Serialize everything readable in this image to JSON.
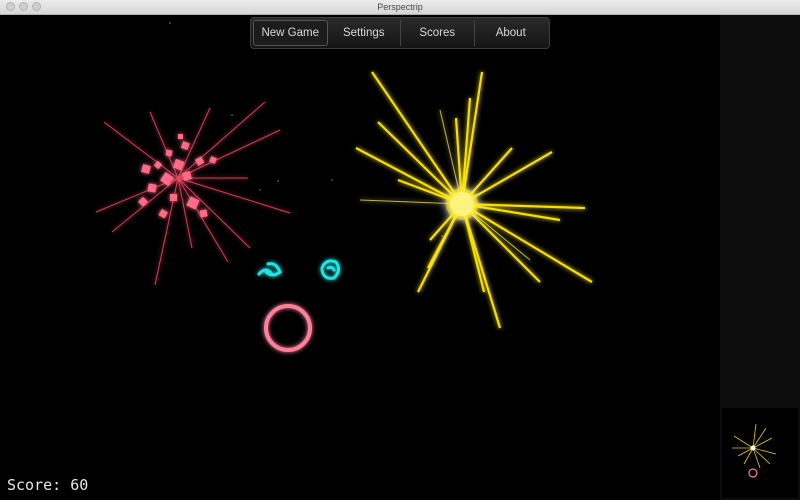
{
  "window": {
    "title": "Perspectrip"
  },
  "menu": {
    "items": [
      {
        "label": "New Game"
      },
      {
        "label": "Settings"
      },
      {
        "label": "Scores"
      },
      {
        "label": "About"
      }
    ]
  },
  "hud": {
    "score_text": "Score: 60"
  },
  "colors": {
    "pink": "#ff5a7a",
    "yellow": "#ffe600",
    "cyan": "#1ee6e6",
    "ring": "#ff7f9a"
  }
}
